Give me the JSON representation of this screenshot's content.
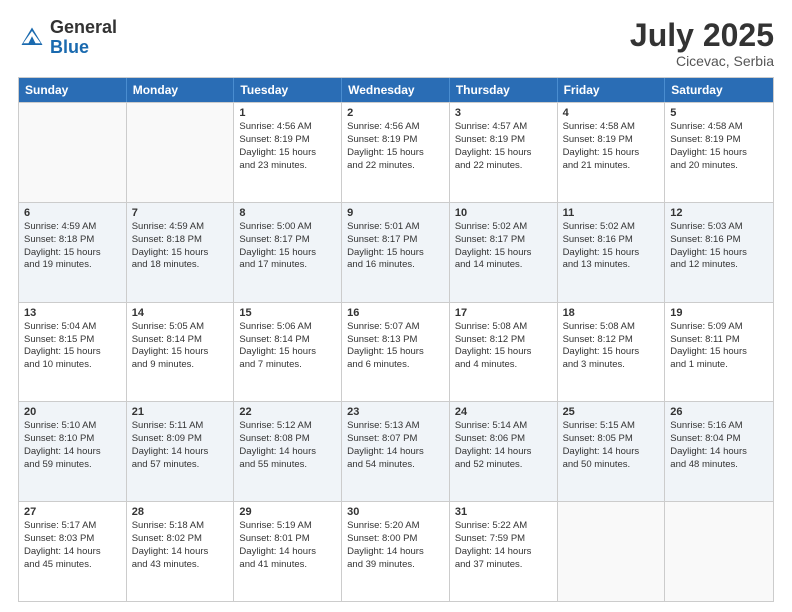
{
  "header": {
    "logo_general": "General",
    "logo_blue": "Blue",
    "month_year": "July 2025",
    "location": "Cicevac, Serbia"
  },
  "weekdays": [
    "Sunday",
    "Monday",
    "Tuesday",
    "Wednesday",
    "Thursday",
    "Friday",
    "Saturday"
  ],
  "rows": [
    {
      "alt": false,
      "cells": [
        {
          "day": "",
          "lines": []
        },
        {
          "day": "",
          "lines": []
        },
        {
          "day": "1",
          "lines": [
            "Sunrise: 4:56 AM",
            "Sunset: 8:19 PM",
            "Daylight: 15 hours",
            "and 23 minutes."
          ]
        },
        {
          "day": "2",
          "lines": [
            "Sunrise: 4:56 AM",
            "Sunset: 8:19 PM",
            "Daylight: 15 hours",
            "and 22 minutes."
          ]
        },
        {
          "day": "3",
          "lines": [
            "Sunrise: 4:57 AM",
            "Sunset: 8:19 PM",
            "Daylight: 15 hours",
            "and 22 minutes."
          ]
        },
        {
          "day": "4",
          "lines": [
            "Sunrise: 4:58 AM",
            "Sunset: 8:19 PM",
            "Daylight: 15 hours",
            "and 21 minutes."
          ]
        },
        {
          "day": "5",
          "lines": [
            "Sunrise: 4:58 AM",
            "Sunset: 8:19 PM",
            "Daylight: 15 hours",
            "and 20 minutes."
          ]
        }
      ]
    },
    {
      "alt": true,
      "cells": [
        {
          "day": "6",
          "lines": [
            "Sunrise: 4:59 AM",
            "Sunset: 8:18 PM",
            "Daylight: 15 hours",
            "and 19 minutes."
          ]
        },
        {
          "day": "7",
          "lines": [
            "Sunrise: 4:59 AM",
            "Sunset: 8:18 PM",
            "Daylight: 15 hours",
            "and 18 minutes."
          ]
        },
        {
          "day": "8",
          "lines": [
            "Sunrise: 5:00 AM",
            "Sunset: 8:17 PM",
            "Daylight: 15 hours",
            "and 17 minutes."
          ]
        },
        {
          "day": "9",
          "lines": [
            "Sunrise: 5:01 AM",
            "Sunset: 8:17 PM",
            "Daylight: 15 hours",
            "and 16 minutes."
          ]
        },
        {
          "day": "10",
          "lines": [
            "Sunrise: 5:02 AM",
            "Sunset: 8:17 PM",
            "Daylight: 15 hours",
            "and 14 minutes."
          ]
        },
        {
          "day": "11",
          "lines": [
            "Sunrise: 5:02 AM",
            "Sunset: 8:16 PM",
            "Daylight: 15 hours",
            "and 13 minutes."
          ]
        },
        {
          "day": "12",
          "lines": [
            "Sunrise: 5:03 AM",
            "Sunset: 8:16 PM",
            "Daylight: 15 hours",
            "and 12 minutes."
          ]
        }
      ]
    },
    {
      "alt": false,
      "cells": [
        {
          "day": "13",
          "lines": [
            "Sunrise: 5:04 AM",
            "Sunset: 8:15 PM",
            "Daylight: 15 hours",
            "and 10 minutes."
          ]
        },
        {
          "day": "14",
          "lines": [
            "Sunrise: 5:05 AM",
            "Sunset: 8:14 PM",
            "Daylight: 15 hours",
            "and 9 minutes."
          ]
        },
        {
          "day": "15",
          "lines": [
            "Sunrise: 5:06 AM",
            "Sunset: 8:14 PM",
            "Daylight: 15 hours",
            "and 7 minutes."
          ]
        },
        {
          "day": "16",
          "lines": [
            "Sunrise: 5:07 AM",
            "Sunset: 8:13 PM",
            "Daylight: 15 hours",
            "and 6 minutes."
          ]
        },
        {
          "day": "17",
          "lines": [
            "Sunrise: 5:08 AM",
            "Sunset: 8:12 PM",
            "Daylight: 15 hours",
            "and 4 minutes."
          ]
        },
        {
          "day": "18",
          "lines": [
            "Sunrise: 5:08 AM",
            "Sunset: 8:12 PM",
            "Daylight: 15 hours",
            "and 3 minutes."
          ]
        },
        {
          "day": "19",
          "lines": [
            "Sunrise: 5:09 AM",
            "Sunset: 8:11 PM",
            "Daylight: 15 hours",
            "and 1 minute."
          ]
        }
      ]
    },
    {
      "alt": true,
      "cells": [
        {
          "day": "20",
          "lines": [
            "Sunrise: 5:10 AM",
            "Sunset: 8:10 PM",
            "Daylight: 14 hours",
            "and 59 minutes."
          ]
        },
        {
          "day": "21",
          "lines": [
            "Sunrise: 5:11 AM",
            "Sunset: 8:09 PM",
            "Daylight: 14 hours",
            "and 57 minutes."
          ]
        },
        {
          "day": "22",
          "lines": [
            "Sunrise: 5:12 AM",
            "Sunset: 8:08 PM",
            "Daylight: 14 hours",
            "and 55 minutes."
          ]
        },
        {
          "day": "23",
          "lines": [
            "Sunrise: 5:13 AM",
            "Sunset: 8:07 PM",
            "Daylight: 14 hours",
            "and 54 minutes."
          ]
        },
        {
          "day": "24",
          "lines": [
            "Sunrise: 5:14 AM",
            "Sunset: 8:06 PM",
            "Daylight: 14 hours",
            "and 52 minutes."
          ]
        },
        {
          "day": "25",
          "lines": [
            "Sunrise: 5:15 AM",
            "Sunset: 8:05 PM",
            "Daylight: 14 hours",
            "and 50 minutes."
          ]
        },
        {
          "day": "26",
          "lines": [
            "Sunrise: 5:16 AM",
            "Sunset: 8:04 PM",
            "Daylight: 14 hours",
            "and 48 minutes."
          ]
        }
      ]
    },
    {
      "alt": false,
      "cells": [
        {
          "day": "27",
          "lines": [
            "Sunrise: 5:17 AM",
            "Sunset: 8:03 PM",
            "Daylight: 14 hours",
            "and 45 minutes."
          ]
        },
        {
          "day": "28",
          "lines": [
            "Sunrise: 5:18 AM",
            "Sunset: 8:02 PM",
            "Daylight: 14 hours",
            "and 43 minutes."
          ]
        },
        {
          "day": "29",
          "lines": [
            "Sunrise: 5:19 AM",
            "Sunset: 8:01 PM",
            "Daylight: 14 hours",
            "and 41 minutes."
          ]
        },
        {
          "day": "30",
          "lines": [
            "Sunrise: 5:20 AM",
            "Sunset: 8:00 PM",
            "Daylight: 14 hours",
            "and 39 minutes."
          ]
        },
        {
          "day": "31",
          "lines": [
            "Sunrise: 5:22 AM",
            "Sunset: 7:59 PM",
            "Daylight: 14 hours",
            "and 37 minutes."
          ]
        },
        {
          "day": "",
          "lines": []
        },
        {
          "day": "",
          "lines": []
        }
      ]
    }
  ]
}
